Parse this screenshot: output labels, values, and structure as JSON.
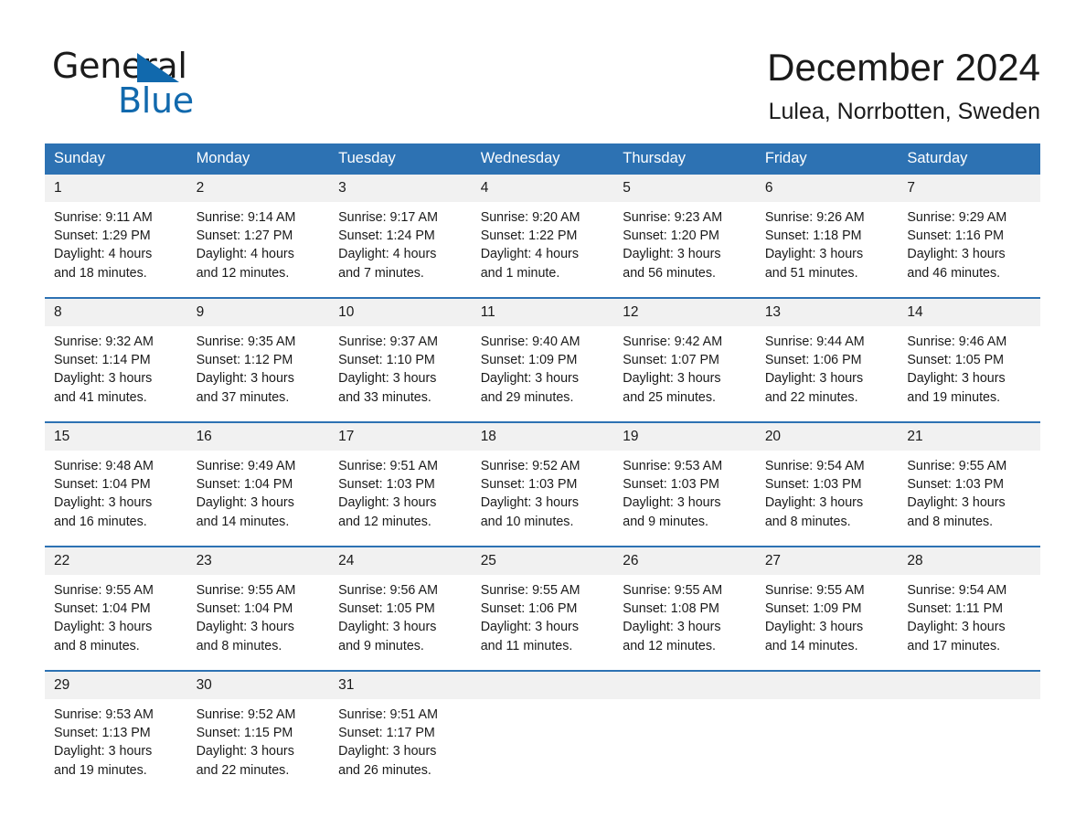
{
  "brand": {
    "name_part1": "General",
    "name_part2": "Blue",
    "accent_color": "#1169ad",
    "triangle_icon": "triangle-icon"
  },
  "header": {
    "month_title": "December 2024",
    "location": "Lulea, Norrbotten, Sweden"
  },
  "theme": {
    "header_blue": "#2d72b3",
    "daynum_band": "#f1f1f1",
    "text": "#1a1a1a"
  },
  "weekdays": [
    "Sunday",
    "Monday",
    "Tuesday",
    "Wednesday",
    "Thursday",
    "Friday",
    "Saturday"
  ],
  "weeks": [
    [
      {
        "day": "1",
        "sunrise": "Sunrise: 9:11 AM",
        "sunset": "Sunset: 1:29 PM",
        "daylight1": "Daylight: 4 hours",
        "daylight2": "and 18 minutes."
      },
      {
        "day": "2",
        "sunrise": "Sunrise: 9:14 AM",
        "sunset": "Sunset: 1:27 PM",
        "daylight1": "Daylight: 4 hours",
        "daylight2": "and 12 minutes."
      },
      {
        "day": "3",
        "sunrise": "Sunrise: 9:17 AM",
        "sunset": "Sunset: 1:24 PM",
        "daylight1": "Daylight: 4 hours",
        "daylight2": "and 7 minutes."
      },
      {
        "day": "4",
        "sunrise": "Sunrise: 9:20 AM",
        "sunset": "Sunset: 1:22 PM",
        "daylight1": "Daylight: 4 hours",
        "daylight2": "and 1 minute."
      },
      {
        "day": "5",
        "sunrise": "Sunrise: 9:23 AM",
        "sunset": "Sunset: 1:20 PM",
        "daylight1": "Daylight: 3 hours",
        "daylight2": "and 56 minutes."
      },
      {
        "day": "6",
        "sunrise": "Sunrise: 9:26 AM",
        "sunset": "Sunset: 1:18 PM",
        "daylight1": "Daylight: 3 hours",
        "daylight2": "and 51 minutes."
      },
      {
        "day": "7",
        "sunrise": "Sunrise: 9:29 AM",
        "sunset": "Sunset: 1:16 PM",
        "daylight1": "Daylight: 3 hours",
        "daylight2": "and 46 minutes."
      }
    ],
    [
      {
        "day": "8",
        "sunrise": "Sunrise: 9:32 AM",
        "sunset": "Sunset: 1:14 PM",
        "daylight1": "Daylight: 3 hours",
        "daylight2": "and 41 minutes."
      },
      {
        "day": "9",
        "sunrise": "Sunrise: 9:35 AM",
        "sunset": "Sunset: 1:12 PM",
        "daylight1": "Daylight: 3 hours",
        "daylight2": "and 37 minutes."
      },
      {
        "day": "10",
        "sunrise": "Sunrise: 9:37 AM",
        "sunset": "Sunset: 1:10 PM",
        "daylight1": "Daylight: 3 hours",
        "daylight2": "and 33 minutes."
      },
      {
        "day": "11",
        "sunrise": "Sunrise: 9:40 AM",
        "sunset": "Sunset: 1:09 PM",
        "daylight1": "Daylight: 3 hours",
        "daylight2": "and 29 minutes."
      },
      {
        "day": "12",
        "sunrise": "Sunrise: 9:42 AM",
        "sunset": "Sunset: 1:07 PM",
        "daylight1": "Daylight: 3 hours",
        "daylight2": "and 25 minutes."
      },
      {
        "day": "13",
        "sunrise": "Sunrise: 9:44 AM",
        "sunset": "Sunset: 1:06 PM",
        "daylight1": "Daylight: 3 hours",
        "daylight2": "and 22 minutes."
      },
      {
        "day": "14",
        "sunrise": "Sunrise: 9:46 AM",
        "sunset": "Sunset: 1:05 PM",
        "daylight1": "Daylight: 3 hours",
        "daylight2": "and 19 minutes."
      }
    ],
    [
      {
        "day": "15",
        "sunrise": "Sunrise: 9:48 AM",
        "sunset": "Sunset: 1:04 PM",
        "daylight1": "Daylight: 3 hours",
        "daylight2": "and 16 minutes."
      },
      {
        "day": "16",
        "sunrise": "Sunrise: 9:49 AM",
        "sunset": "Sunset: 1:04 PM",
        "daylight1": "Daylight: 3 hours",
        "daylight2": "and 14 minutes."
      },
      {
        "day": "17",
        "sunrise": "Sunrise: 9:51 AM",
        "sunset": "Sunset: 1:03 PM",
        "daylight1": "Daylight: 3 hours",
        "daylight2": "and 12 minutes."
      },
      {
        "day": "18",
        "sunrise": "Sunrise: 9:52 AM",
        "sunset": "Sunset: 1:03 PM",
        "daylight1": "Daylight: 3 hours",
        "daylight2": "and 10 minutes."
      },
      {
        "day": "19",
        "sunrise": "Sunrise: 9:53 AM",
        "sunset": "Sunset: 1:03 PM",
        "daylight1": "Daylight: 3 hours",
        "daylight2": "and 9 minutes."
      },
      {
        "day": "20",
        "sunrise": "Sunrise: 9:54 AM",
        "sunset": "Sunset: 1:03 PM",
        "daylight1": "Daylight: 3 hours",
        "daylight2": "and 8 minutes."
      },
      {
        "day": "21",
        "sunrise": "Sunrise: 9:55 AM",
        "sunset": "Sunset: 1:03 PM",
        "daylight1": "Daylight: 3 hours",
        "daylight2": "and 8 minutes."
      }
    ],
    [
      {
        "day": "22",
        "sunrise": "Sunrise: 9:55 AM",
        "sunset": "Sunset: 1:04 PM",
        "daylight1": "Daylight: 3 hours",
        "daylight2": "and 8 minutes."
      },
      {
        "day": "23",
        "sunrise": "Sunrise: 9:55 AM",
        "sunset": "Sunset: 1:04 PM",
        "daylight1": "Daylight: 3 hours",
        "daylight2": "and 8 minutes."
      },
      {
        "day": "24",
        "sunrise": "Sunrise: 9:56 AM",
        "sunset": "Sunset: 1:05 PM",
        "daylight1": "Daylight: 3 hours",
        "daylight2": "and 9 minutes."
      },
      {
        "day": "25",
        "sunrise": "Sunrise: 9:55 AM",
        "sunset": "Sunset: 1:06 PM",
        "daylight1": "Daylight: 3 hours",
        "daylight2": "and 11 minutes."
      },
      {
        "day": "26",
        "sunrise": "Sunrise: 9:55 AM",
        "sunset": "Sunset: 1:08 PM",
        "daylight1": "Daylight: 3 hours",
        "daylight2": "and 12 minutes."
      },
      {
        "day": "27",
        "sunrise": "Sunrise: 9:55 AM",
        "sunset": "Sunset: 1:09 PM",
        "daylight1": "Daylight: 3 hours",
        "daylight2": "and 14 minutes."
      },
      {
        "day": "28",
        "sunrise": "Sunrise: 9:54 AM",
        "sunset": "Sunset: 1:11 PM",
        "daylight1": "Daylight: 3 hours",
        "daylight2": "and 17 minutes."
      }
    ],
    [
      {
        "day": "29",
        "sunrise": "Sunrise: 9:53 AM",
        "sunset": "Sunset: 1:13 PM",
        "daylight1": "Daylight: 3 hours",
        "daylight2": "and 19 minutes."
      },
      {
        "day": "30",
        "sunrise": "Sunrise: 9:52 AM",
        "sunset": "Sunset: 1:15 PM",
        "daylight1": "Daylight: 3 hours",
        "daylight2": "and 22 minutes."
      },
      {
        "day": "31",
        "sunrise": "Sunrise: 9:51 AM",
        "sunset": "Sunset: 1:17 PM",
        "daylight1": "Daylight: 3 hours",
        "daylight2": "and 26 minutes."
      },
      {
        "day": "",
        "sunrise": "",
        "sunset": "",
        "daylight1": "",
        "daylight2": ""
      },
      {
        "day": "",
        "sunrise": "",
        "sunset": "",
        "daylight1": "",
        "daylight2": ""
      },
      {
        "day": "",
        "sunrise": "",
        "sunset": "",
        "daylight1": "",
        "daylight2": ""
      },
      {
        "day": "",
        "sunrise": "",
        "sunset": "",
        "daylight1": "",
        "daylight2": ""
      }
    ]
  ]
}
